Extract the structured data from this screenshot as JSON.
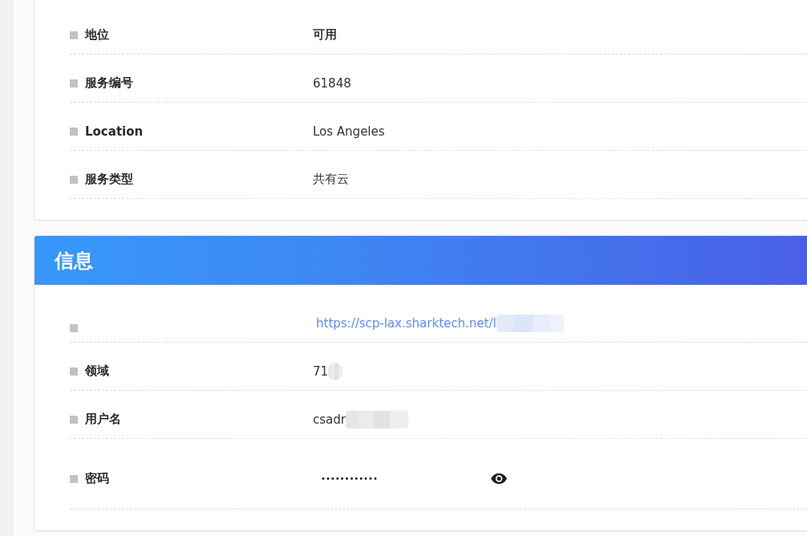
{
  "status_card": {
    "rows": [
      {
        "label": "地位",
        "value": "可用",
        "kind": "status"
      },
      {
        "label": "服务编号",
        "value": "61848",
        "kind": "text"
      },
      {
        "label": "Location",
        "value": "Los Angeles",
        "kind": "text"
      },
      {
        "label": "服务类型",
        "value": "共有云",
        "kind": "text"
      }
    ]
  },
  "info_card": {
    "title": "信息",
    "rows": [
      {
        "value": "https://scp-lax.sharktech.net/l",
        "kind": "link",
        "redacted": true
      },
      {
        "label": "领域",
        "value": "71",
        "kind": "text",
        "redacted": true
      },
      {
        "label": "用户名",
        "value": "csadr",
        "kind": "text",
        "redacted": true
      },
      {
        "label": "密码",
        "value": "••••••••••••",
        "kind": "password"
      }
    ]
  }
}
